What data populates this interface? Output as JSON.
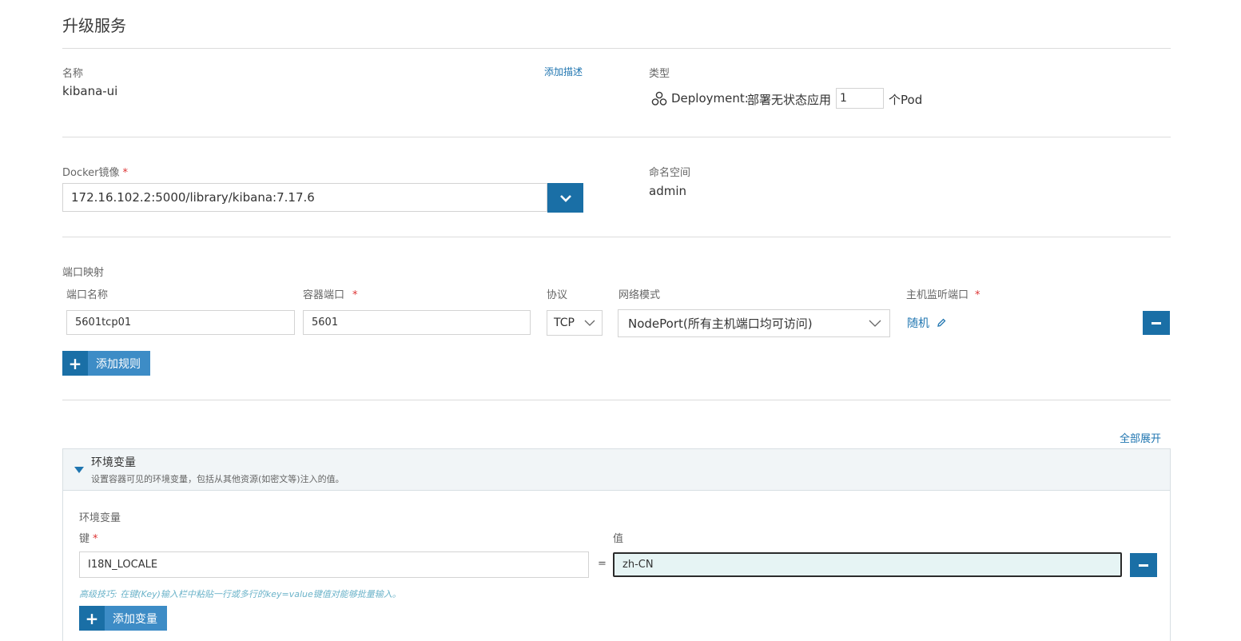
{
  "page": {
    "title": "升级服务"
  },
  "name": {
    "label": "名称",
    "value": "kibana-ui",
    "add_desc": "添加描述"
  },
  "type": {
    "label": "类型",
    "deployment": "Deployment:",
    "desc": "部署无状态应用",
    "pods_value": "1",
    "pods_suffix": "个Pod"
  },
  "docker": {
    "label": "Docker镜像",
    "required": "*",
    "image": "172.16.102.2:5000/library/kibana:7.17.6"
  },
  "namespace": {
    "label": "命名空间",
    "value": "admin"
  },
  "ports": {
    "section_label": "端口映射",
    "headers": {
      "name": "端口名称",
      "container": "容器端口",
      "protocol": "协议",
      "network": "网络模式",
      "host": "主机监听端口"
    },
    "required": "*",
    "row": {
      "name": "5601tcp01",
      "container": "5601",
      "protocol": "TCP",
      "network": "NodePort(所有主机端口均可访问)",
      "host": "随机"
    },
    "add_label": "添加规则"
  },
  "expand_all": "全部展开",
  "env": {
    "title": "环境变量",
    "subtitle": "设置容器可见的环境变量，包括从其他资源(如密文等)注入的值。",
    "inner_label": "环境变量",
    "key_label": "键",
    "value_label": "值",
    "required": "*",
    "row": {
      "key": "I18N_LOCALE",
      "eq": "=",
      "value": "zh-CN"
    },
    "tip": "高级技巧: 在键(Key)输入栏中粘贴一行或多行的key=value键值对能够批量输入。",
    "add_label": "添加变量"
  },
  "colors": {
    "accent": "#1a6fa6",
    "link": "#1f75b0",
    "tip": "#6bb3c9"
  }
}
